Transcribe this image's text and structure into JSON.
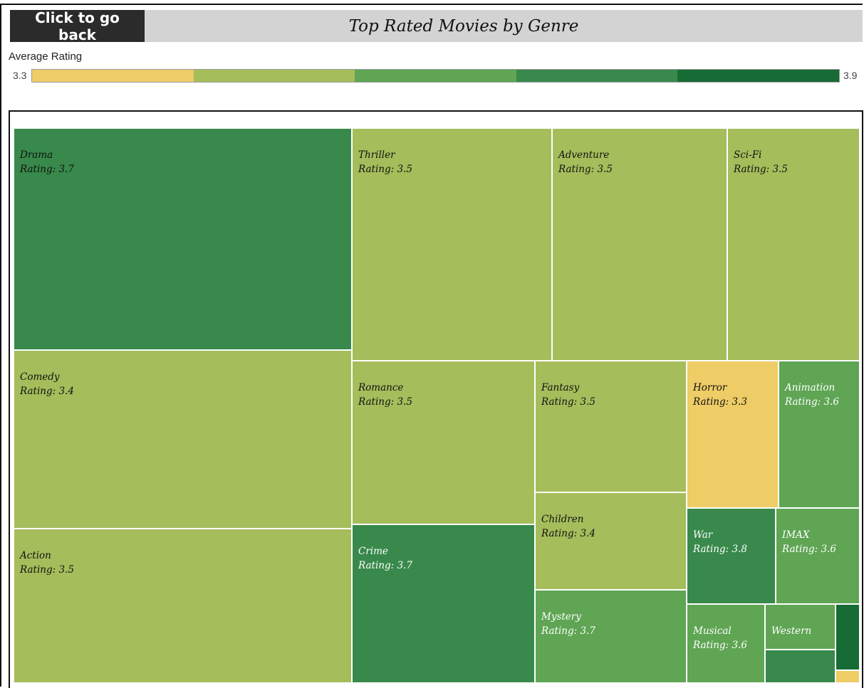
{
  "header": {
    "back_label": "Click to go back",
    "title": "Top Rated Movies by Genre"
  },
  "legend": {
    "title": "Average Rating",
    "min_label": "3.3",
    "max_label": "3.9",
    "colors": [
      "#eecc66",
      "#a5bd5b",
      "#5fa554",
      "#38894b",
      "#176b35"
    ]
  },
  "rating_prefix": "Rating: ",
  "chart_data": {
    "type": "treemap",
    "title": "Top Rated Movies by Genre",
    "color_scale": {
      "label": "Average Rating",
      "min": 3.3,
      "max": 3.9
    },
    "items": [
      {
        "name": "Drama",
        "rating": "3.7",
        "color": "#38894b",
        "text": "light"
      },
      {
        "name": "Comedy",
        "rating": "3.4",
        "color": "#a5bd5b",
        "text": "light"
      },
      {
        "name": "Action",
        "rating": "3.5",
        "color": "#a5bd5b",
        "text": "light"
      },
      {
        "name": "Thriller",
        "rating": "3.5",
        "color": "#a5bd5b",
        "text": "light"
      },
      {
        "name": "Adventure",
        "rating": "3.5",
        "color": "#a5bd5b",
        "text": "light"
      },
      {
        "name": "Sci-Fi",
        "rating": "3.5",
        "color": "#a5bd5b",
        "text": "light"
      },
      {
        "name": "Romance",
        "rating": "3.5",
        "color": "#a5bd5b",
        "text": "light"
      },
      {
        "name": "Crime",
        "rating": "3.7",
        "color": "#38894b",
        "text": "dark"
      },
      {
        "name": "Fantasy",
        "rating": "3.5",
        "color": "#a5bd5b",
        "text": "light"
      },
      {
        "name": "Children",
        "rating": "3.4",
        "color": "#a5bd5b",
        "text": "light"
      },
      {
        "name": "Mystery",
        "rating": "3.7",
        "color": "#5fa554",
        "text": "dark"
      },
      {
        "name": "Horror",
        "rating": "3.3",
        "color": "#eecc66",
        "text": "light"
      },
      {
        "name": "Animation",
        "rating": "3.6",
        "color": "#5fa554",
        "text": "dark"
      },
      {
        "name": "War",
        "rating": "3.8",
        "color": "#38894b",
        "text": "dark"
      },
      {
        "name": "IMAX",
        "rating": "3.6",
        "color": "#5fa554",
        "text": "dark"
      },
      {
        "name": "Musical",
        "rating": "3.6",
        "color": "#5fa554",
        "text": "dark"
      },
      {
        "name": "Western",
        "rating": "",
        "color": "#5fa554",
        "text": "dark"
      },
      {
        "name": "",
        "rating": "",
        "color": "#38894b",
        "text": "dark"
      },
      {
        "name": "",
        "rating": "",
        "color": "#176b35",
        "text": "dark"
      },
      {
        "name": "",
        "rating": "",
        "color": "#eecc66",
        "text": "dark"
      }
    ]
  }
}
